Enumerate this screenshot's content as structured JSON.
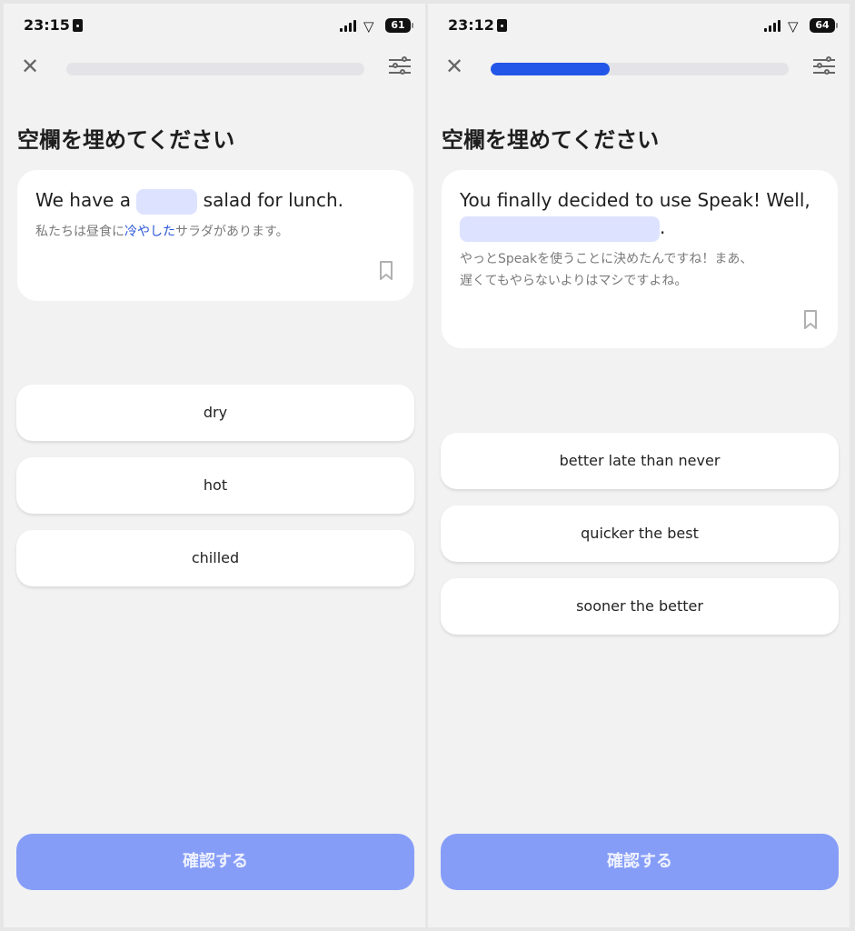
{
  "left": {
    "status": {
      "time": "23:15",
      "battery": "61"
    },
    "progress_fraction": 0.0,
    "title": "空欄を埋めてください",
    "sentence": {
      "before": "We have a",
      "after": "salad for lunch."
    },
    "translation": {
      "before": "私たちは昼食に",
      "highlight": "冷やした",
      "after": "サラダがあります。"
    },
    "options": [
      "dry",
      "hot",
      "chilled"
    ],
    "confirm_label": "確認する"
  },
  "right": {
    "status": {
      "time": "23:12",
      "battery": "64"
    },
    "progress_fraction": 0.4,
    "title": "空欄を埋めてください",
    "sentence": {
      "line1": "You finally decided to use Speak! Well,",
      "after": "."
    },
    "translation": {
      "line1": "やっとSpeakを使うことに決めたんですね！まあ、",
      "line2": "遅くてもやらないよりはマシですよね。"
    },
    "options": [
      "better late than never",
      "quicker the best",
      "sooner the better"
    ],
    "confirm_label": "確認する"
  },
  "colors": {
    "accent": "#2256e8",
    "blank": "#dde3ff",
    "confirm": "#869df8",
    "highlight": "#2a56d9"
  },
  "icons": [
    "lock-icon",
    "signal-icon",
    "wifi-icon",
    "battery-icon",
    "close-icon",
    "settings-icon",
    "bookmark-icon"
  ]
}
